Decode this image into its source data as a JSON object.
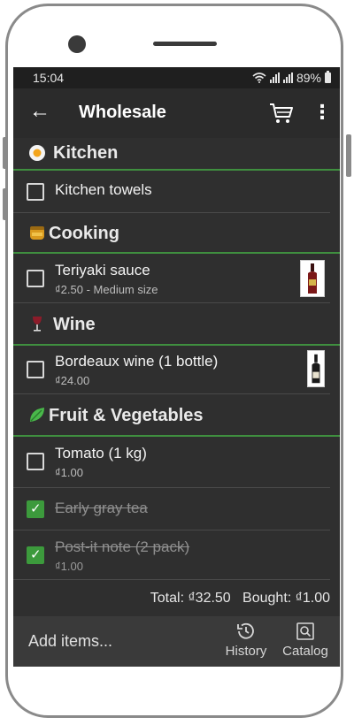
{
  "status": {
    "time": "15:04",
    "battery": "89%"
  },
  "appbar": {
    "title": "Wholesale",
    "back_icon": "←",
    "more_icon": "⋮"
  },
  "categories": [
    {
      "label": "Kitchen",
      "icon": "fried-egg-icon"
    },
    {
      "label": "Cooking",
      "icon": "honey-pot-icon"
    },
    {
      "label": "Wine",
      "icon": "wine-glass-icon"
    },
    {
      "label": "Fruit & Vegetables",
      "icon": "leaf-icon"
    }
  ],
  "items": [
    {
      "name": "Kitchen towels",
      "checked": false
    },
    {
      "name": "Teriyaki sauce",
      "sub": "₫2.50 - Medium size",
      "checked": false
    },
    {
      "name": "Bordeaux wine (1 bottle)",
      "sub": "₫24.00",
      "checked": false
    },
    {
      "name": "Tomato (1 kg)",
      "sub": "₫1.00",
      "checked": false
    },
    {
      "name": "Early gray tea",
      "checked": true
    },
    {
      "name": "Post-it note (2 pack)",
      "sub": "₫1.00",
      "checked": true
    }
  ],
  "totals": {
    "total": "Total: ₫32.50",
    "bought": "Bought: ₫1.00"
  },
  "bottom": {
    "add_placeholder": "Add items...",
    "history_label": "History",
    "catalog_label": "Catalog"
  },
  "colors": {
    "accent": "#3c9a3c",
    "background": "#2f2f2f",
    "bar": "#1f1f1f"
  }
}
